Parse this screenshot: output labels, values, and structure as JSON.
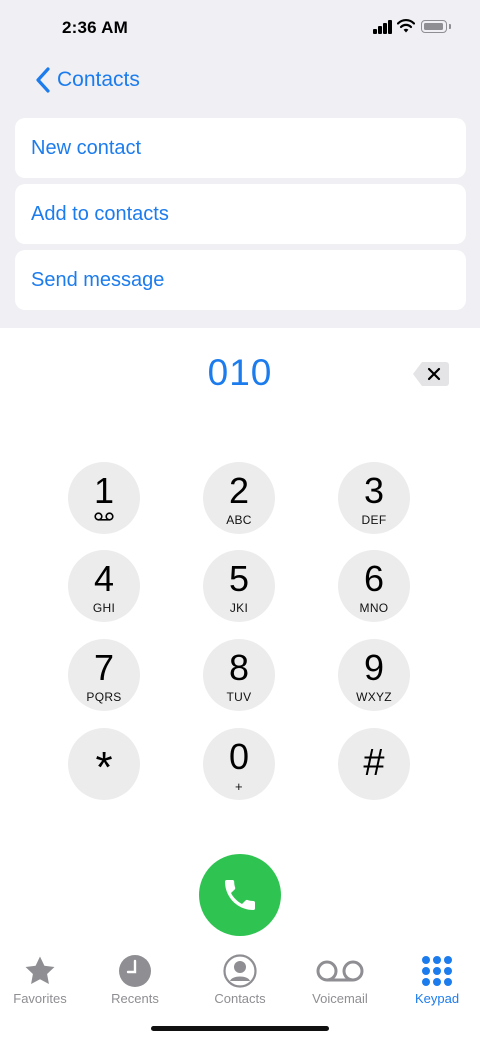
{
  "status": {
    "time": "2:36 AM"
  },
  "nav": {
    "back_label": "Contacts"
  },
  "actions": [
    "New contact",
    "Add to contacts",
    "Send message"
  ],
  "dialed_number": "010",
  "keypad": [
    {
      "digit": "1",
      "letters": ""
    },
    {
      "digit": "2",
      "letters": "ABC"
    },
    {
      "digit": "3",
      "letters": "DEF"
    },
    {
      "digit": "4",
      "letters": "GHI"
    },
    {
      "digit": "5",
      "letters": "JKI"
    },
    {
      "digit": "6",
      "letters": "MNO"
    },
    {
      "digit": "7",
      "letters": "PQRS"
    },
    {
      "digit": "8",
      "letters": "TUV"
    },
    {
      "digit": "9",
      "letters": "WXYZ"
    },
    {
      "digit": "*",
      "letters": ""
    },
    {
      "digit": "0",
      "letters": "+"
    },
    {
      "digit": "#",
      "letters": ""
    }
  ],
  "tabs": [
    {
      "label": "Favorites",
      "icon": "star-icon"
    },
    {
      "label": "Recents",
      "icon": "clock-icon"
    },
    {
      "label": "Contacts",
      "icon": "person-circle-icon"
    },
    {
      "label": "Voicemail",
      "icon": "voicemail-icon"
    },
    {
      "label": "Keypad",
      "icon": "keypad-grid-icon"
    }
  ],
  "active_tab": "Keypad",
  "colors": {
    "accent": "#1c7ced",
    "call": "#2fc452",
    "key_bg": "#ececec",
    "inactive": "#8e8e93"
  }
}
